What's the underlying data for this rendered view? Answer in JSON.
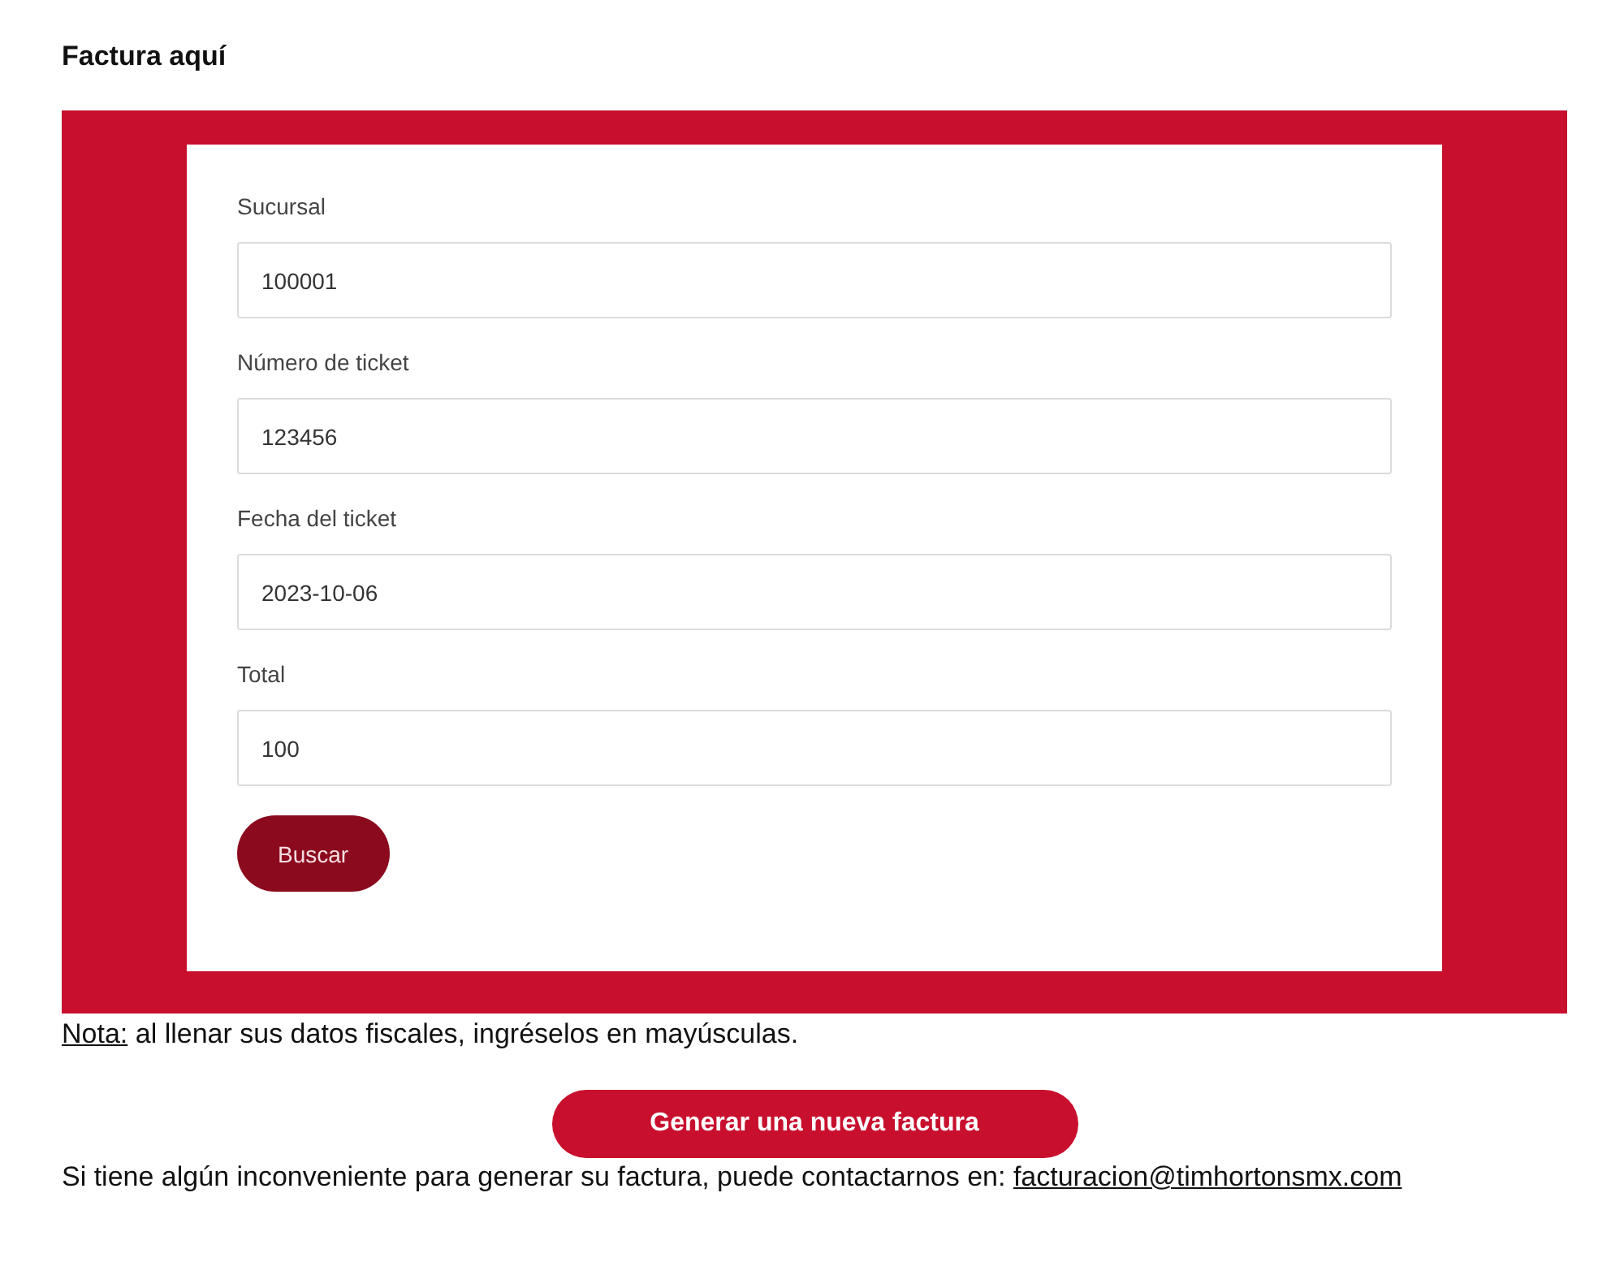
{
  "heading": "Factura aquí",
  "form": {
    "fields": [
      {
        "label": "Sucursal",
        "value": "100001"
      },
      {
        "label": "Número de ticket",
        "value": "123456"
      },
      {
        "label": "Fecha del ticket",
        "value": "2023-10-06"
      },
      {
        "label": "Total",
        "value": "100"
      }
    ],
    "submit_button": "Buscar"
  },
  "note": {
    "label": "Nota:",
    "text": "al llenar sus datos fiscales, ingréselos en mayúsculas."
  },
  "new_invoice_button": "Generar una nueva factura",
  "contact": {
    "text": "Si tiene algún inconveniente para generar su factura, puede contactarnos en:",
    "email": "facturacion@timhortonsmx.com"
  }
}
